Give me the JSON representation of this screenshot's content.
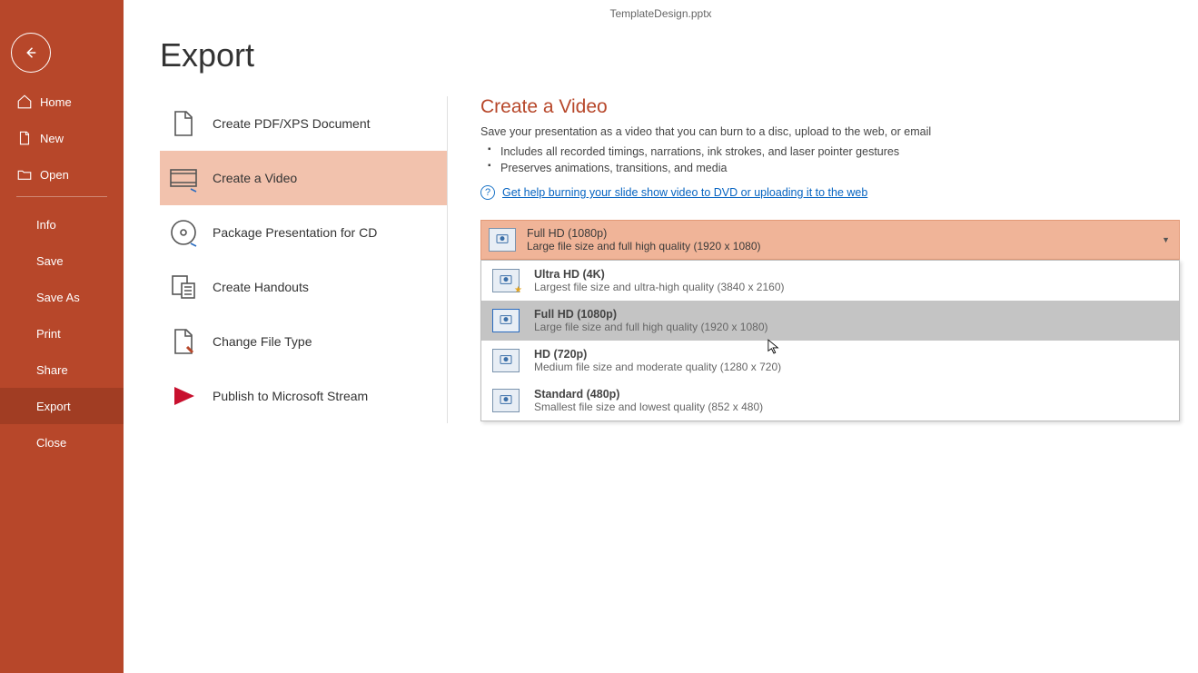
{
  "titlebar": {
    "filename": "TemplateDesign.pptx"
  },
  "page": {
    "title": "Export"
  },
  "sidebar": {
    "top": [
      {
        "label": "Home"
      },
      {
        "label": "New"
      },
      {
        "label": "Open"
      }
    ],
    "bottom": [
      {
        "label": "Info"
      },
      {
        "label": "Save"
      },
      {
        "label": "Save As"
      },
      {
        "label": "Print"
      },
      {
        "label": "Share"
      },
      {
        "label": "Export"
      },
      {
        "label": "Close"
      }
    ]
  },
  "export_list": {
    "items": [
      {
        "label": "Create PDF/XPS Document"
      },
      {
        "label": "Create a Video"
      },
      {
        "label": "Package Presentation for CD"
      },
      {
        "label": "Create Handouts"
      },
      {
        "label": "Change File Type"
      },
      {
        "label": "Publish to Microsoft Stream"
      }
    ]
  },
  "detail": {
    "heading": "Create a Video",
    "subtitle": "Save your presentation as a video that you can burn to a disc, upload to the web, or email",
    "bullets": [
      "Includes all recorded timings, narrations, ink strokes, and laser pointer gestures",
      "Preserves animations, transitions, and media"
    ],
    "help_link": "Get help burning your slide show video to DVD or uploading it to the web"
  },
  "dropdown": {
    "selected": {
      "title": "Full HD (1080p)",
      "desc": "Large file size and full high quality (1920 x 1080)"
    },
    "options": [
      {
        "title": "Ultra HD (4K)",
        "desc": "Largest file size and ultra-high quality (3840 x 2160)"
      },
      {
        "title": "Full HD (1080p)",
        "desc": "Large file size and full high quality (1920 x 1080)"
      },
      {
        "title": "HD (720p)",
        "desc": "Medium file size and moderate quality (1280 x 720)"
      },
      {
        "title": "Standard (480p)",
        "desc": "Smallest file size and lowest quality (852 x 480)"
      }
    ]
  }
}
